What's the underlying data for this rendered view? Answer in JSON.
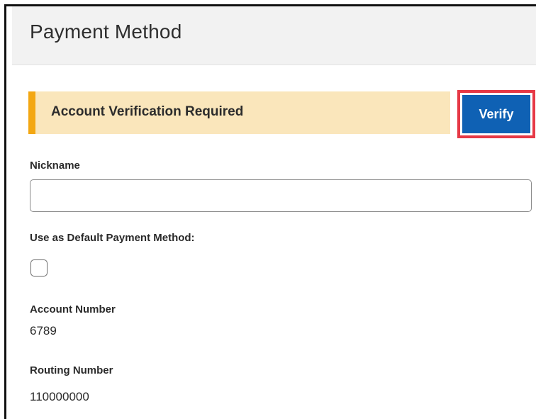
{
  "header": {
    "title": "Payment Method"
  },
  "alert": {
    "message": "Account Verification Required",
    "action_label": "Verify"
  },
  "form": {
    "nickname": {
      "label": "Nickname",
      "value": "",
      "placeholder": ""
    },
    "default_method": {
      "label": "Use as Default Payment Method:",
      "checked": false
    },
    "account_number": {
      "label": "Account Number",
      "value": "6789"
    },
    "routing_number": {
      "label": "Routing Number",
      "value": "110000000"
    }
  },
  "colors": {
    "header_bg": "#f2f2f2",
    "alert_bg": "#fae6bb",
    "alert_accent": "#f3a712",
    "button_bg": "#0f61b4",
    "highlight": "#e63946"
  }
}
